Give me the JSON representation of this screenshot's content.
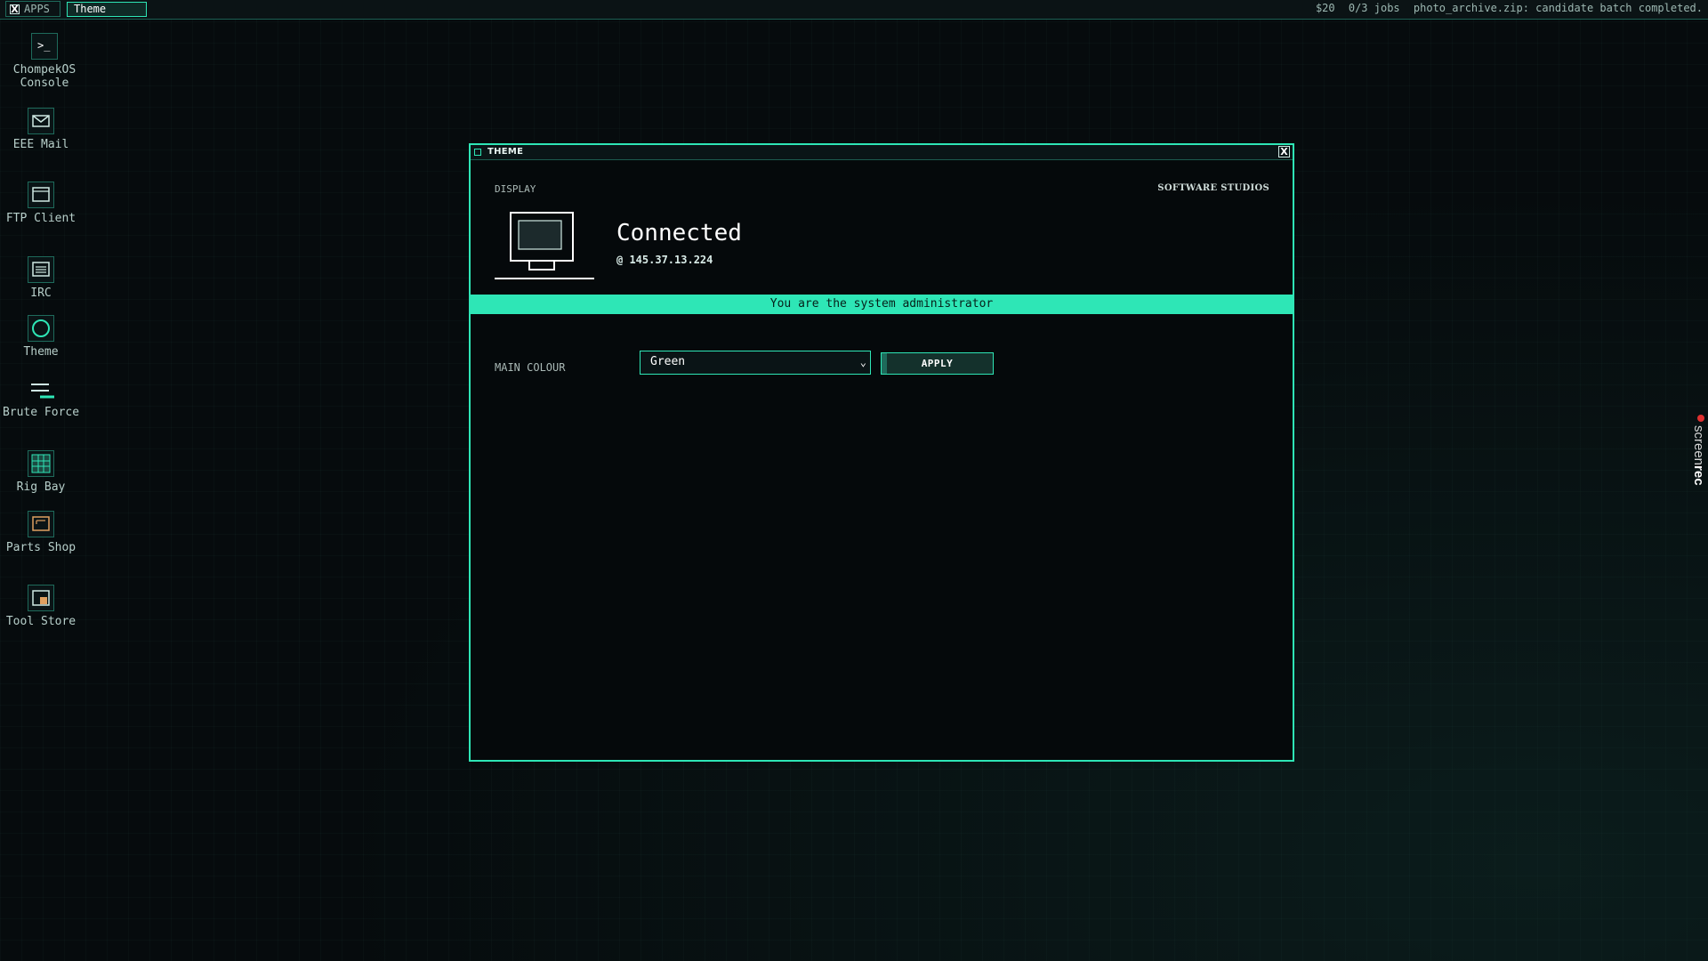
{
  "taskbar": {
    "apps_label": "APPS",
    "close_glyph": "X",
    "active_task": "Theme",
    "status": {
      "money": "$20",
      "jobs": "0/3 jobs",
      "message": "photo_archive.zip: candidate batch completed."
    }
  },
  "desktop": {
    "icons": [
      {
        "icon": "terminal-icon",
        "glyph": ">_",
        "label": "ChompekOS Console"
      },
      {
        "icon": "mail-icon",
        "label": "EEE Mail"
      },
      {
        "icon": "ftp-icon",
        "label": "FTP Client"
      },
      {
        "icon": "chat-icon",
        "label": "IRC"
      },
      {
        "icon": "theme-icon",
        "label": "Theme"
      },
      {
        "icon": "brute-force-icon",
        "label": "Brute Force"
      },
      {
        "icon": "rig-icon",
        "label": "Rig Bay"
      },
      {
        "icon": "parts-icon",
        "label": "Parts Shop"
      },
      {
        "icon": "tool-store-icon",
        "label": "Tool Store"
      }
    ]
  },
  "window": {
    "title": "THEME",
    "close_glyph": "X",
    "display_label": "DISPLAY",
    "vendor": "SOFTWARE STUDIOS",
    "status_title": "Connected",
    "status_ip": "@ 145.37.13.224",
    "banner": "You are the system administrator",
    "colour_label": "MAIN COLOUR",
    "colour_value": "Green",
    "apply_label": "APPLY"
  },
  "colors": {
    "accent": "#2ee6b6",
    "background": "#060b0d",
    "window_bg": "#05090b",
    "border_dim": "#1e6a5b"
  },
  "overlay": {
    "screenrec_left": "screen",
    "screenrec_right": "rec"
  }
}
